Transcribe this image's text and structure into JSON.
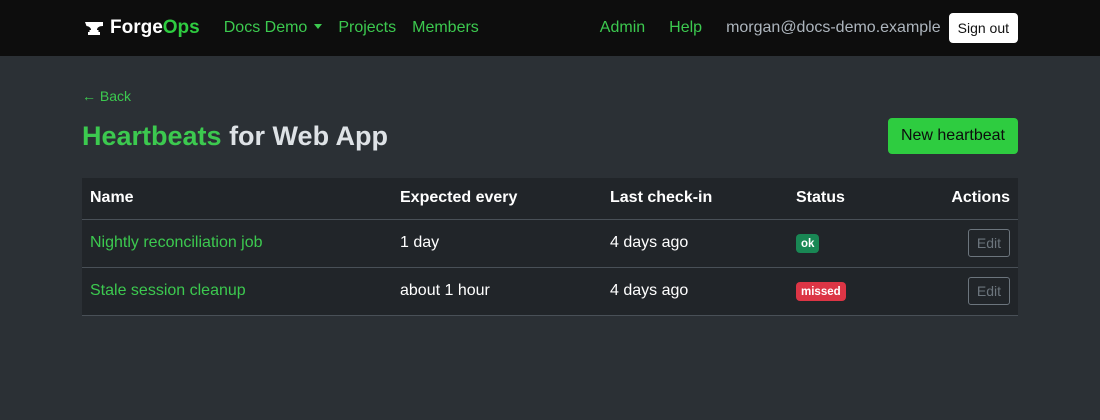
{
  "nav": {
    "brand_part1": "Forge",
    "brand_part2": "Ops",
    "org_dropdown": "Docs Demo",
    "projects": "Projects",
    "members": "Members",
    "admin": "Admin",
    "help": "Help",
    "user_email": "morgan@docs-demo.example",
    "sign_out": "Sign out"
  },
  "page": {
    "back": "← Back",
    "title_accent": "Heartbeats",
    "title_rest": " for Web App",
    "new_button": "New heartbeat"
  },
  "table": {
    "headers": {
      "name": "Name",
      "expected": "Expected every",
      "last_checkin": "Last check-in",
      "status": "Status",
      "actions": "Actions"
    },
    "rows": [
      {
        "name": "Nightly reconciliation job",
        "expected": "1 day",
        "last_checkin": "4 days ago",
        "status": "ok",
        "status_color": "#198754",
        "action": "Edit"
      },
      {
        "name": "Stale session cleanup",
        "expected": "about 1 hour",
        "last_checkin": "4 days ago",
        "status": "missed",
        "status_color": "#dc3545",
        "action": "Edit"
      }
    ]
  },
  "colors": {
    "accent": "#3cc94f",
    "background": "#2b3035",
    "navbar": "#0d0d0d"
  },
  "icons": {
    "brand": "anvil-icon",
    "dropdown": "caret-down-icon",
    "back": "arrow-left-icon"
  }
}
